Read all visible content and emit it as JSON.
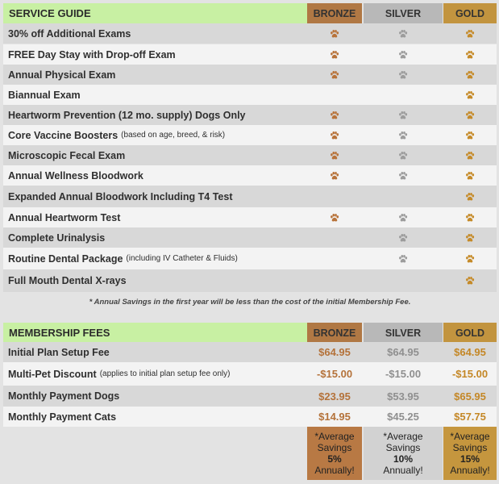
{
  "service_guide": {
    "title": "SERVICE GUIDE",
    "tiers": [
      "BRONZE",
      "SILVER",
      "GOLD"
    ],
    "rows": [
      {
        "label": "30% off Additional Exams",
        "note": "",
        "bronze": true,
        "silver": true,
        "gold": true
      },
      {
        "label": "FREE Day Stay with Drop-off Exam",
        "note": "",
        "bronze": true,
        "silver": true,
        "gold": true
      },
      {
        "label": "Annual Physical Exam",
        "note": "",
        "bronze": true,
        "silver": true,
        "gold": true
      },
      {
        "label": "Biannual Exam",
        "note": "",
        "bronze": false,
        "silver": false,
        "gold": true
      },
      {
        "label": "Heartworm Prevention (12 mo. supply) Dogs Only",
        "note": "",
        "bronze": true,
        "silver": true,
        "gold": true
      },
      {
        "label": "Core Vaccine Boosters",
        "note": "(based on age, breed, & risk)",
        "bronze": true,
        "silver": true,
        "gold": true
      },
      {
        "label": "Microscopic Fecal Exam",
        "note": "",
        "bronze": true,
        "silver": true,
        "gold": true
      },
      {
        "label": "Annual Wellness Bloodwork",
        "note": "",
        "bronze": true,
        "silver": true,
        "gold": true
      },
      {
        "label": "Expanded Annual Bloodwork Including T4 Test",
        "note": "",
        "bronze": false,
        "silver": false,
        "gold": true
      },
      {
        "label": "Annual Heartworm Test",
        "note": "",
        "bronze": true,
        "silver": true,
        "gold": true
      },
      {
        "label": "Complete Urinalysis",
        "note": "",
        "bronze": false,
        "silver": true,
        "gold": true
      },
      {
        "label": "Routine Dental Package",
        "note": "(including IV Catheter & Fluids)",
        "bronze": false,
        "silver": true,
        "gold": true
      },
      {
        "label": "Full Mouth Dental X-rays",
        "note": "",
        "bronze": false,
        "silver": false,
        "gold": true
      }
    ],
    "footnote": "* Annual Savings in the first year will be less than the cost of the initial Membership Fee."
  },
  "membership_fees": {
    "title": "MEMBERSHIP FEES",
    "tiers": [
      "BRONZE",
      "SILVER",
      "GOLD"
    ],
    "rows": [
      {
        "label": "Initial Plan Setup Fee",
        "note": "",
        "bronze": "$64.95",
        "silver": "$64.95",
        "gold": "$64.95"
      },
      {
        "label": "Multi-Pet Discount",
        "note": "(applies to initial plan setup fee only)",
        "bronze": "-$15.00",
        "silver": "-$15.00",
        "gold": "-$15.00"
      },
      {
        "label": "Monthly Payment Dogs",
        "note": "",
        "bronze": "$23.95",
        "silver": "$53.95",
        "gold": "$65.95"
      },
      {
        "label": "Monthly Payment Cats",
        "note": "",
        "bronze": "$14.95",
        "silver": "$45.25",
        "gold": "$57.75"
      }
    ],
    "savings": {
      "line1": "*Average",
      "line2": "Savings",
      "line4": "Annually!",
      "bronze": "5%",
      "silver": "10%",
      "gold": "15%"
    }
  },
  "icons": {
    "check": "paw-icon"
  },
  "colors": {
    "header_green": "#c8f0a3",
    "bronze": "#b07844",
    "silver": "#b8b8b8",
    "gold": "#c2943f"
  }
}
